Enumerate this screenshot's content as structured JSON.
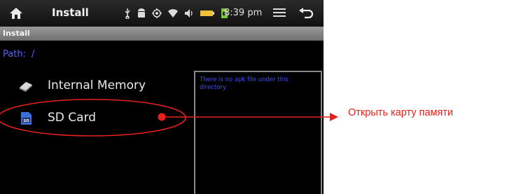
{
  "statusbar": {
    "title": "Install",
    "time": "8:39 pm",
    "icons": [
      "home-icon",
      "usb-icon",
      "android-icon",
      "gps-icon",
      "wifi-icon",
      "volume-icon",
      "battery-icon",
      "sd-notification-icon",
      "menu-icon",
      "back-icon"
    ]
  },
  "window": {
    "title": "Install"
  },
  "path": {
    "label": "Path:",
    "value": "/"
  },
  "items": [
    {
      "label": "Internal Memory",
      "icon": "internal-memory-icon"
    },
    {
      "label": "SD Card",
      "icon": "sd-card-icon"
    }
  ],
  "panel": {
    "message": "There is no apk file under this directory"
  },
  "annotation": {
    "text": "Открыть карту памяти",
    "color": "#e8211c"
  },
  "colors": {
    "accent": "#5a63ff",
    "panel_text": "#3d4cff",
    "annotation": "#e8211c"
  }
}
